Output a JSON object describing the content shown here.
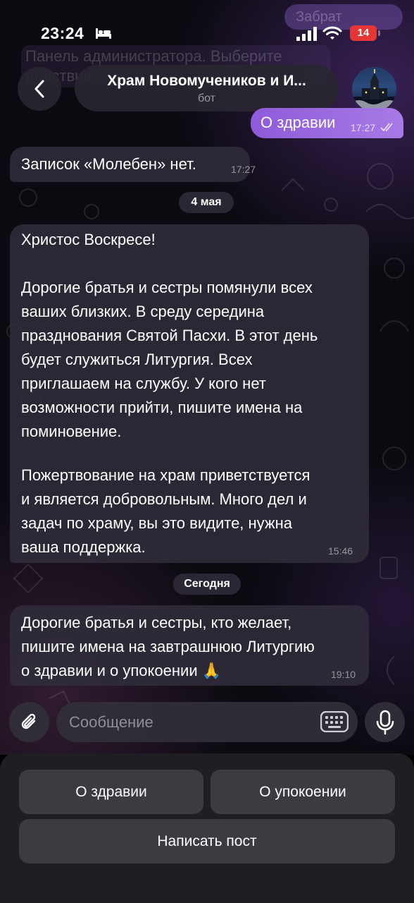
{
  "status_bar": {
    "time": "23:24",
    "battery_level": "14",
    "icons": [
      "bed-icon",
      "signal-icon",
      "wifi-icon",
      "battery-icon"
    ]
  },
  "background_overlay": {
    "pill_text": "Забрат",
    "admin_text": "Панель администратора. Выберите действие"
  },
  "header": {
    "title": "Храм Новомучеников и И...",
    "subtitle": "бот",
    "back_icon": "chevron-left-icon",
    "avatar": "church-avatar"
  },
  "messages": [
    {
      "direction": "out",
      "text": "О здравии",
      "time": "17:27",
      "status": "read"
    },
    {
      "direction": "in",
      "text": "Записок «Молебен» нет.",
      "time": "17:27"
    },
    {
      "type": "date",
      "label": "4 мая"
    },
    {
      "direction": "in",
      "lines": [
        "Христос Воскресе!",
        "",
        "Дорогие братья и сестры помянули всех",
        "ваших близких. В среду середина",
        "празднования Святой Пасхи. В этот день",
        "будет служиться Литургия. Всех",
        "приглашаем на службу. У кого нет",
        "возможности прийти, пишите имена на",
        "поминовение.",
        "",
        "Пожертвование на храм приветствуется",
        "и является добровольным. Много дел и",
        "задач по храму, вы это видите, нужна",
        "ваша поддержка."
      ],
      "time": "15:46"
    },
    {
      "type": "date",
      "label": "Сегодня"
    },
    {
      "direction": "in",
      "lines": [
        "Дорогие братья и сестры, кто желает,",
        "пишите имена на завтрашнюю Литургию",
        "о здравии и о упокоении 🙏"
      ],
      "time": "19:10"
    }
  ],
  "composer": {
    "placeholder": "Сообщение",
    "attach_icon": "paperclip-icon",
    "keyboard_icon": "keyboard-icon",
    "mic_icon": "microphone-icon"
  },
  "bot_keyboard": {
    "row1": [
      "О здравии",
      "О упокоении"
    ],
    "row2": [
      "Написать пост"
    ]
  },
  "colors": {
    "accent": "#9b6be0",
    "bubble_in": "#302c3a",
    "panel": "#1f1e23",
    "button": "#3c3b41",
    "battery": "#e63535"
  }
}
